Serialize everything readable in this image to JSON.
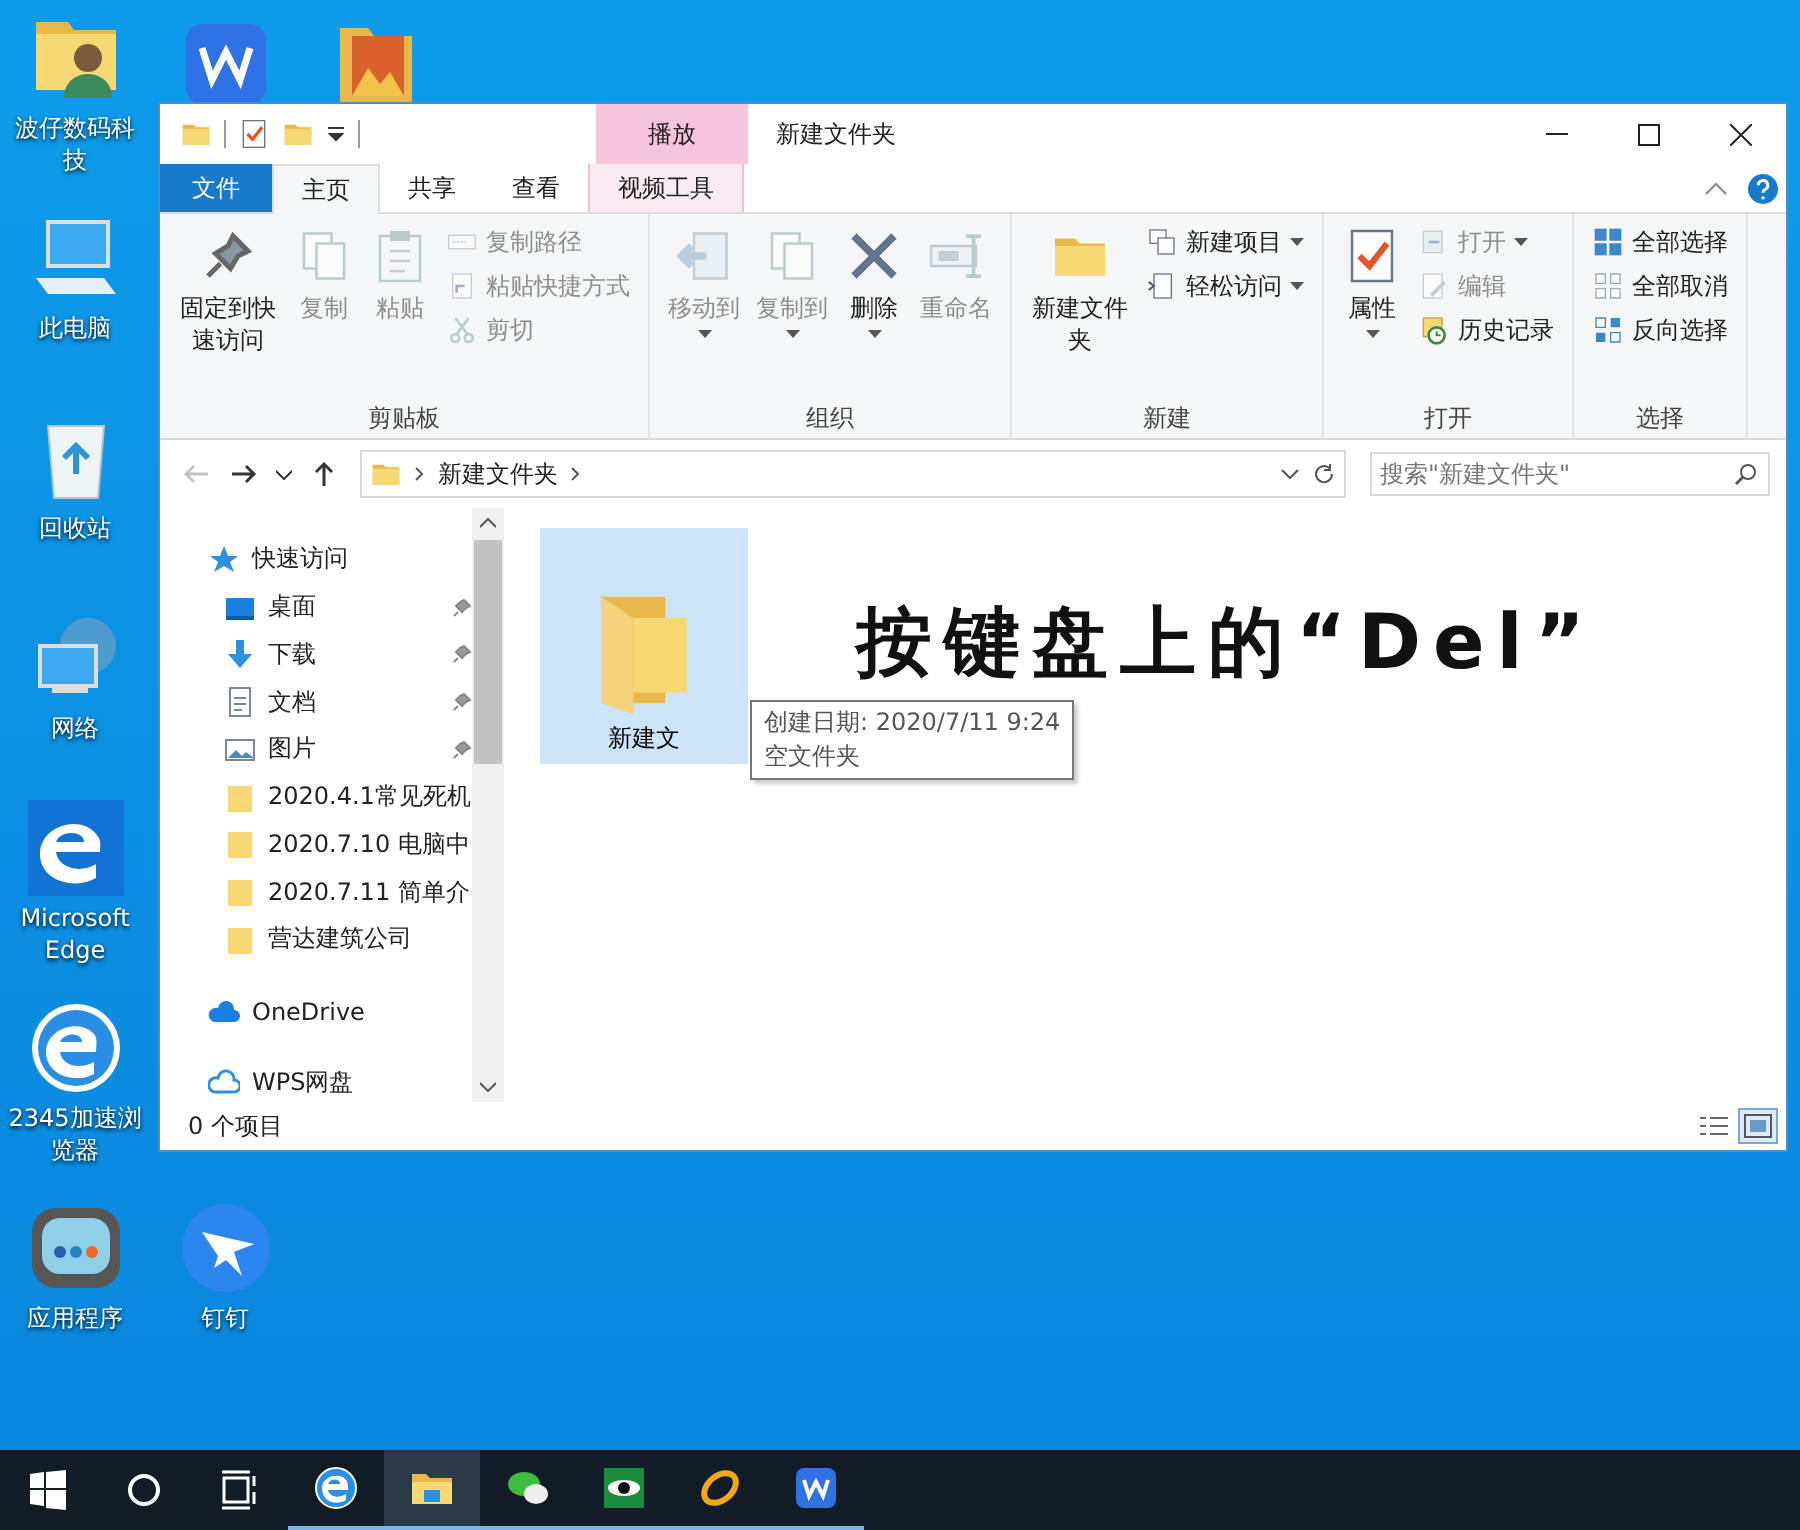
{
  "desktop_icons": [
    {
      "kind": "user-folder",
      "label": "波仔数码科技"
    },
    {
      "kind": "office"
    },
    {
      "kind": "photo-folder"
    },
    {
      "kind": "computer",
      "label": "此电脑"
    },
    {
      "kind": "recycle-bin",
      "label": "回收站"
    },
    {
      "kind": "network",
      "label": "网络"
    },
    {
      "kind": "edge",
      "label": "Microsoft Edge"
    },
    {
      "kind": "browser",
      "label": "2345加速浏览器"
    },
    {
      "kind": "apps",
      "label": "应用程序"
    },
    {
      "kind": "plane",
      "label": "钉钉"
    }
  ],
  "window": {
    "title": "新建文件夹",
    "context_group": "播放",
    "tabs": [
      {
        "label": "文件",
        "kind": "file",
        "selected": false
      },
      {
        "label": "主页",
        "kind": "normal",
        "selected": true
      },
      {
        "label": "共享",
        "kind": "normal",
        "selected": false
      },
      {
        "label": "查看",
        "kind": "normal",
        "selected": false
      },
      {
        "label": "视频工具",
        "kind": "contextual",
        "selected": false
      }
    ],
    "ribbon_groups": [
      {
        "name": "剪贴板",
        "items": [
          {
            "kind": "large",
            "label": "固定到快速访问",
            "disabled": false,
            "dropdown": false
          },
          {
            "kind": "large",
            "label": "复制",
            "disabled": true,
            "dropdown": false
          },
          {
            "kind": "large",
            "label": "粘贴",
            "disabled": true,
            "dropdown": false
          },
          {
            "kind": "small",
            "label": "复制路径",
            "disabled": true,
            "dropdown": false
          },
          {
            "kind": "small",
            "label": "粘贴快捷方式",
            "disabled": true,
            "dropdown": false
          },
          {
            "kind": "small",
            "label": "剪切",
            "disabled": true,
            "dropdown": false
          }
        ]
      },
      {
        "name": "组织",
        "items": [
          {
            "kind": "large",
            "label": "移动到",
            "disabled": true,
            "dropdown": true
          },
          {
            "kind": "large",
            "label": "复制到",
            "disabled": true,
            "dropdown": true
          },
          {
            "kind": "large",
            "label": "删除",
            "disabled": false,
            "dropdown": true
          },
          {
            "kind": "large",
            "label": "重命名",
            "disabled": true,
            "dropdown": false
          }
        ]
      },
      {
        "name": "新建",
        "items": [
          {
            "kind": "large",
            "label": "新建文件夹",
            "disabled": false,
            "dropdown": false
          },
          {
            "kind": "small",
            "label": "新建项目",
            "disabled": false,
            "dropdown": true
          },
          {
            "kind": "small",
            "label": "轻松访问",
            "disabled": false,
            "dropdown": true
          }
        ]
      },
      {
        "name": "打开",
        "items": [
          {
            "kind": "large",
            "label": "属性",
            "disabled": false,
            "dropdown": true
          },
          {
            "kind": "small",
            "label": "打开",
            "disabled": true,
            "dropdown": true
          },
          {
            "kind": "small",
            "label": "编辑",
            "disabled": true,
            "dropdown": false
          },
          {
            "kind": "small",
            "label": "历史记录",
            "disabled": false,
            "dropdown": false
          }
        ]
      },
      {
        "name": "选择",
        "items": [
          {
            "kind": "small",
            "label": "全部选择",
            "disabled": false,
            "dropdown": false
          },
          {
            "kind": "small",
            "label": "全部取消",
            "disabled": false,
            "dropdown": false
          },
          {
            "kind": "small",
            "label": "反向选择",
            "disabled": false,
            "dropdown": false
          }
        ]
      }
    ],
    "nav_buttons": [
      {
        "kind": "back",
        "disabled": true
      },
      {
        "kind": "forward",
        "disabled": false
      },
      {
        "kind": "recent",
        "disabled": false
      },
      {
        "kind": "up",
        "disabled": false
      }
    ],
    "address": {
      "path": "新建文件夹"
    },
    "search": {
      "placeholder": "搜索\"新建文件夹\""
    },
    "nav_pane": [
      {
        "kind": "star",
        "label": "快速访问",
        "children": [
          {
            "kind": "desktop",
            "label": "桌面",
            "pinned": true
          },
          {
            "kind": "download",
            "label": "下载",
            "pinned": true
          },
          {
            "kind": "document",
            "label": "文档",
            "pinned": true
          },
          {
            "kind": "picture",
            "label": "图片",
            "pinned": true
          },
          {
            "kind": "folder",
            "label": "2020.4.1常见死机",
            "pinned": false
          },
          {
            "kind": "folder",
            "label": "2020.7.10 电脑中",
            "pinned": false
          },
          {
            "kind": "folder",
            "label": "2020.7.11 简单介",
            "pinned": false
          },
          {
            "kind": "folder",
            "label": "营达建筑公司",
            "pinned": false
          }
        ]
      },
      {
        "kind": "cloud",
        "label": "OneDrive"
      },
      {
        "kind": "cloud-outline",
        "label": "WPS网盘"
      }
    ],
    "files": [
      {
        "name": "新建文",
        "selected": true
      }
    ],
    "tooltip": [
      "创建日期: 2020/7/11 9:24",
      "空文件夹"
    ],
    "status": "0 个项目",
    "view_buttons": [
      {
        "kind": "details",
        "selected": false
      },
      {
        "kind": "large-icons",
        "selected": true
      }
    ]
  },
  "annotation": "按键盘上的“Del”",
  "taskbar": {
    "buttons": [
      {
        "kind": "start"
      },
      {
        "kind": "search"
      },
      {
        "kind": "task-view"
      }
    ],
    "apps": [
      {
        "kind": "browser",
        "active": false,
        "running": true
      },
      {
        "kind": "files",
        "active": true,
        "running": true
      },
      {
        "kind": "chat",
        "active": false,
        "running": true
      },
      {
        "kind": "eye",
        "active": false,
        "running": true
      },
      {
        "kind": "ring",
        "active": false,
        "running": true
      },
      {
        "kind": "office",
        "active": false,
        "running": true
      }
    ]
  }
}
